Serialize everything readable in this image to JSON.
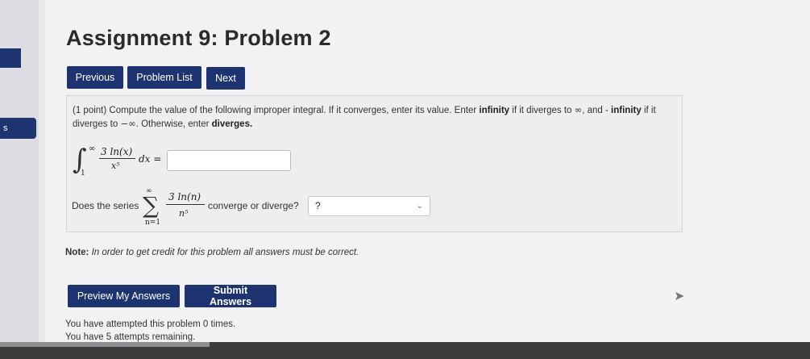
{
  "page": {
    "title": "Assignment 9: Problem 2",
    "left_tab_text": "s"
  },
  "nav": {
    "previous": "Previous",
    "problem_list": "Problem List",
    "next": "Next"
  },
  "problem": {
    "points": "(1 point)",
    "text_1": "Compute the value of the following improper integral. If it converges, enter its value. Enter",
    "infinity_word": "infinity",
    "text_2": "if it diverges to",
    "infinity_symbol": "∞",
    "text_3": ", and -",
    "neg_infinity_word": "infinity",
    "text_4": "if it diverges to",
    "neg_infinity_symbol": "−∞",
    "text_5": ". Otherwise, enter",
    "diverges_word": "diverges.",
    "integral": {
      "sign": "∫",
      "upper": "∞",
      "lower": "1",
      "numerator": "3 ln(x)",
      "denominator": "x⁵",
      "dx": "dx ="
    },
    "answer_value": "",
    "series_question_prefix": "Does the series",
    "series": {
      "sigma": "∑",
      "upper": "∞",
      "lower": "n=1",
      "numerator": "3 ln(n)",
      "denominator": "n⁵"
    },
    "series_question_suffix": "converge or diverge?",
    "select_value": "?"
  },
  "note": {
    "label": "Note:",
    "text": "In order to get credit for this problem all answers must be correct."
  },
  "actions": {
    "preview": "Preview My Answers",
    "submit": "Submit Answers"
  },
  "status": {
    "attempted": "You have attempted this problem 0 times.",
    "remaining": "You have 5 attempts remaining."
  },
  "colors": {
    "button_bg": "#1e3470",
    "page_bg": "#f2f2f4"
  }
}
